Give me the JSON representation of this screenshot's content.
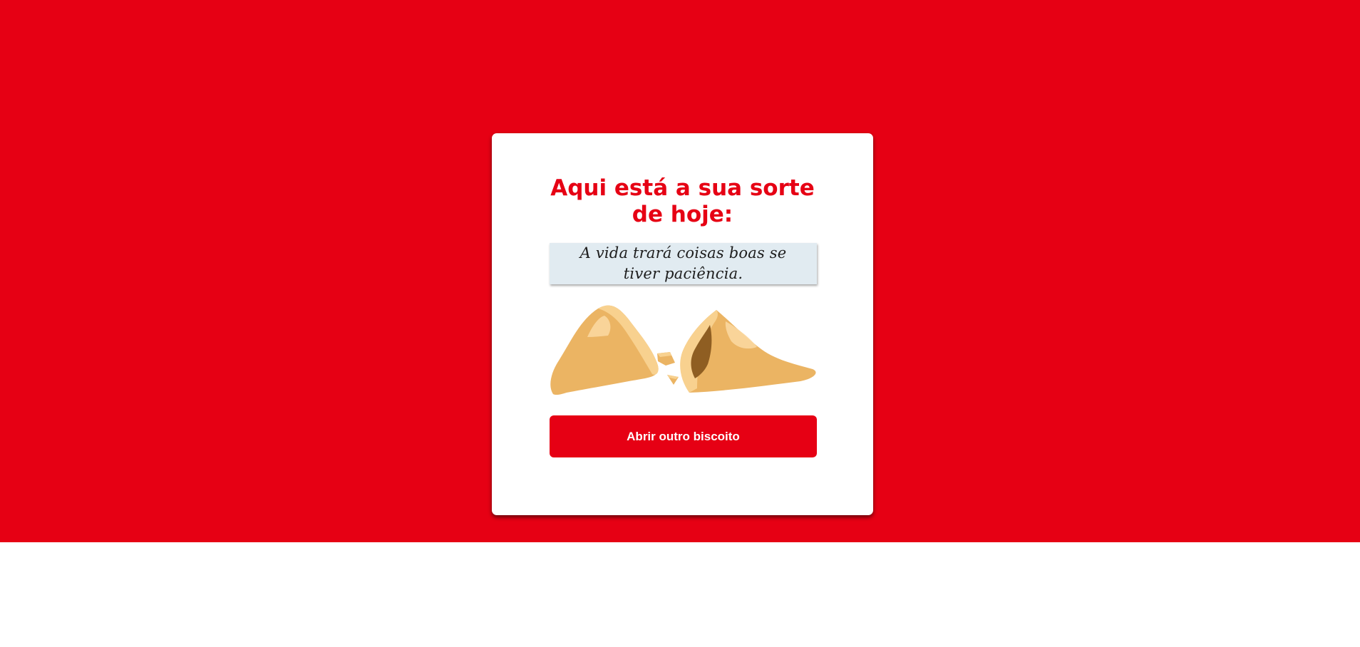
{
  "colors": {
    "brand_red": "#e60014",
    "card_background": "#ffffff",
    "fortune_background": "#e1ebf1",
    "cookie_light": "#ebb463",
    "cookie_edge": "#f8d18f",
    "cookie_inner": "#8f5e22"
  },
  "fortune_card": {
    "title": "Aqui está a sua sorte de hoje:",
    "fortune_text": "A vida trará coisas boas se tiver paciência.",
    "illustration_icon": "broken-fortune-cookie-icon",
    "button_label": "Abrir outro biscoito"
  }
}
